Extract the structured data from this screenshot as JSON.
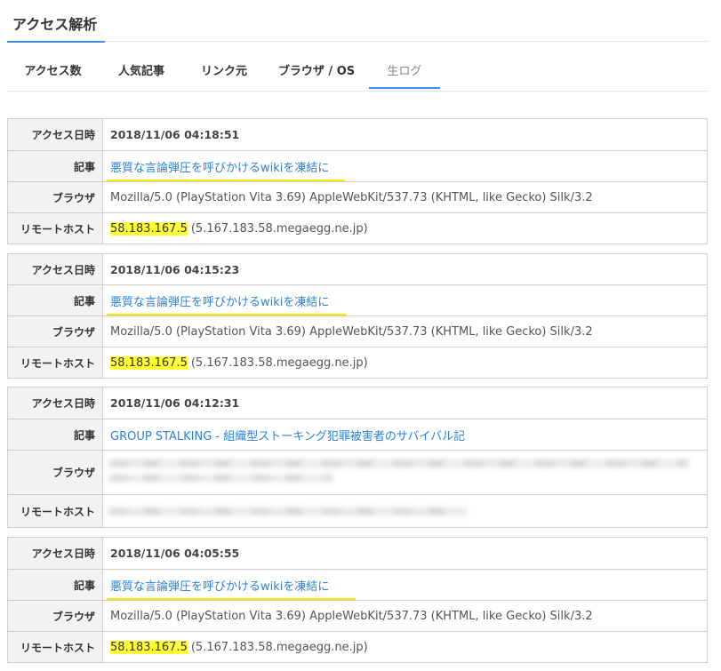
{
  "header": {
    "title": "アクセス解析"
  },
  "tabs": [
    {
      "label": "アクセス数"
    },
    {
      "label": "人気記事"
    },
    {
      "label": "リンク元"
    },
    {
      "label": "ブラウザ / OS"
    },
    {
      "label": "生ログ",
      "active": true
    }
  ],
  "labels": {
    "date": "アクセス日時",
    "article": "記事",
    "browser": "ブラウザ",
    "host": "リモートホスト"
  },
  "entries": [
    {
      "date": "2018/11/06 04:18:51",
      "article": "悪質な言論弾圧を呼びかけるwikiを凍結に",
      "browser": "Mozilla/5.0 (PlayStation Vita 3.69) AppleWebKit/537.73 (KHTML, like Gecko) Silk/3.2",
      "ip": "58.183.167.5",
      "host": "(5.167.183.58.megaegg.ne.jp)"
    },
    {
      "date": "2018/11/06 04:15:23",
      "article": "悪質な言論弾圧を呼びかけるwikiを凍結に",
      "browser": "Mozilla/5.0 (PlayStation Vita 3.69) AppleWebKit/537.73 (KHTML, like Gecko) Silk/3.2",
      "ip": "58.183.167.5",
      "host": "(5.167.183.58.megaegg.ne.jp)"
    },
    {
      "date": "2018/11/06 04:12:31",
      "article": "GROUP STALKING - 組織型ストーキング犯罪被害者のサバイバル記",
      "browser": "",
      "ip": "",
      "host": ""
    },
    {
      "date": "2018/11/06 04:05:55",
      "article": "悪質な言論弾圧を呼びかけるwikiを凍結に",
      "browser": "Mozilla/5.0 (PlayStation Vita 3.69) AppleWebKit/537.73 (KHTML, like Gecko) Silk/3.2",
      "ip": "58.183.167.5",
      "host": "(5.167.183.58.megaegg.ne.jp)"
    }
  ],
  "colors": {
    "accent": "#3a8ee6",
    "link": "#2a82d8",
    "ip_highlight": "#ffff33",
    "marker": "#ffe600"
  }
}
